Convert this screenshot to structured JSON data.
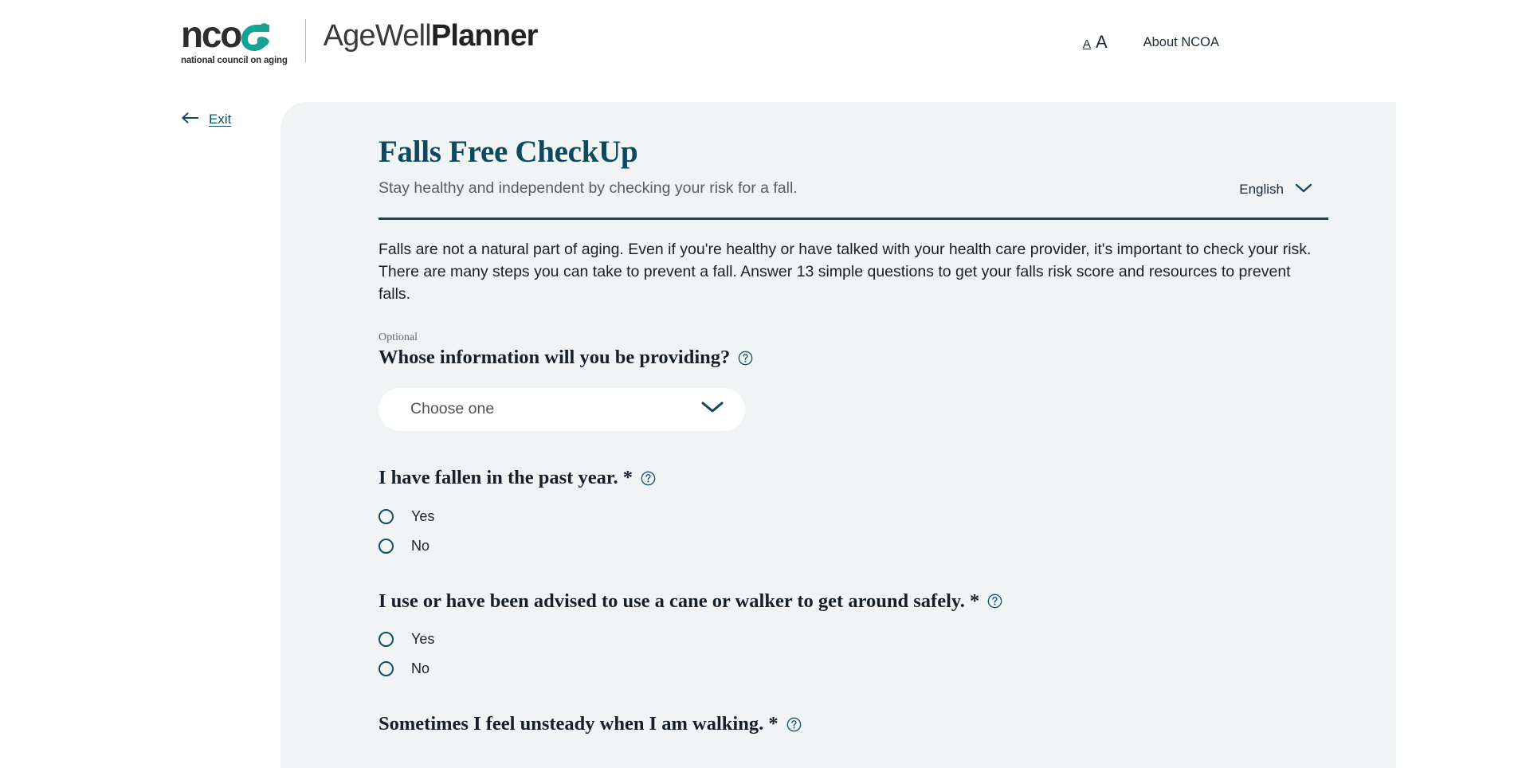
{
  "header": {
    "logo": {
      "ncoa_letters": "nco",
      "ncoa_tagline": "national council on aging",
      "product_light": "AgeWell",
      "product_bold": "Planner",
      "swoosh_color": "#17a394"
    },
    "text_size_small": "A",
    "text_size_large": "A",
    "about_link": "About NCOA"
  },
  "exit": {
    "label": "Exit",
    "icon": "arrow-left-icon"
  },
  "card": {
    "title": "Falls Free CheckUp",
    "subtitle": "Stay healthy and independent by checking your risk for a fall.",
    "language": {
      "selected": "English",
      "icon": "chevron-down-icon"
    },
    "intro": "Falls are not a natural part of aging. Even if you're healthy or have talked with your health care provider, it's important to check your risk. There are many steps you can take to prevent a fall. Answer 13 simple questions to get your falls risk score and resources to prevent falls.",
    "accent_color": "#0e4a5f",
    "background_color": "#f0f4f5"
  },
  "questions": [
    {
      "optional_tag": "Optional",
      "text": "Whose information will you be providing?",
      "required_marker": "",
      "help_icon": "help-circle-icon",
      "type": "select",
      "placeholder": "Choose one"
    },
    {
      "optional_tag": "",
      "text": "I have fallen in the past year.",
      "required_marker": "*",
      "help_icon": "help-circle-icon",
      "type": "radio",
      "options": [
        "Yes",
        "No"
      ]
    },
    {
      "optional_tag": "",
      "text": "I use or have been advised to use a cane or walker to get around safely.",
      "required_marker": "*",
      "help_icon": "help-circle-icon",
      "type": "radio",
      "options": [
        "Yes",
        "No"
      ]
    },
    {
      "optional_tag": "",
      "text": "Sometimes I feel unsteady when I am walking.",
      "required_marker": "*",
      "help_icon": "help-circle-icon",
      "type": "radio",
      "options": []
    }
  ]
}
